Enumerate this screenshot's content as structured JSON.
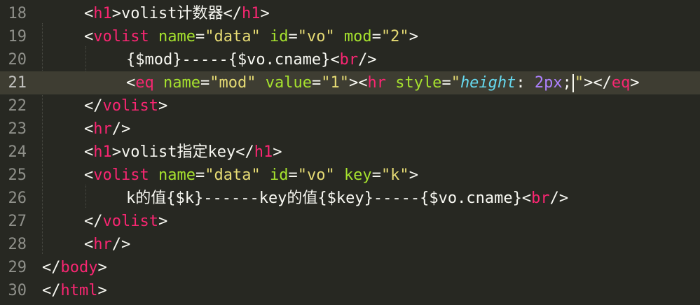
{
  "colors": {
    "background": "#272822",
    "current_line": "#3E3D32",
    "tag": "#F92672",
    "attribute": "#A6E22E",
    "string": "#E6DB74",
    "text": "#F8F8F2",
    "css_property": "#66D9EF",
    "number": "#AE81FF",
    "line_number": "#8F908A"
  },
  "editor": {
    "current_line_number": 21,
    "lines": [
      {
        "number": "18",
        "tokens": [
          {
            "t": "<",
            "k": "punct"
          },
          {
            "t": "h1",
            "k": "tag"
          },
          {
            "t": ">",
            "k": "punct"
          },
          {
            "t": "volist计数器",
            "k": "text"
          },
          {
            "t": "</",
            "k": "punct"
          },
          {
            "t": "h1",
            "k": "tag"
          },
          {
            "t": ">",
            "k": "punct"
          }
        ]
      },
      {
        "number": "19",
        "tokens": [
          {
            "t": "<",
            "k": "punct"
          },
          {
            "t": "volist",
            "k": "tag"
          },
          {
            "t": " ",
            "k": "text"
          },
          {
            "t": "name",
            "k": "attr"
          },
          {
            "t": "=",
            "k": "punct"
          },
          {
            "t": "\"data\"",
            "k": "str"
          },
          {
            "t": " ",
            "k": "text"
          },
          {
            "t": "id",
            "k": "attr"
          },
          {
            "t": "=",
            "k": "punct"
          },
          {
            "t": "\"vo\"",
            "k": "str"
          },
          {
            "t": " ",
            "k": "text"
          },
          {
            "t": "mod",
            "k": "attr"
          },
          {
            "t": "=",
            "k": "punct"
          },
          {
            "t": "\"2\"",
            "k": "str"
          },
          {
            "t": ">",
            "k": "punct"
          }
        ]
      },
      {
        "number": "20",
        "tokens": [
          {
            "t": "{$mod}-----{$vo.cname}",
            "k": "text"
          },
          {
            "t": "<",
            "k": "punct"
          },
          {
            "t": "br",
            "k": "tag"
          },
          {
            "t": "/>",
            "k": "punct"
          }
        ]
      },
      {
        "number": "21",
        "tokens": [
          {
            "t": "<",
            "k": "punct"
          },
          {
            "t": "eq",
            "k": "tag"
          },
          {
            "t": " ",
            "k": "text"
          },
          {
            "t": "name",
            "k": "attr"
          },
          {
            "t": "=",
            "k": "punct"
          },
          {
            "t": "\"mod\"",
            "k": "str"
          },
          {
            "t": " ",
            "k": "text"
          },
          {
            "t": "value",
            "k": "attr"
          },
          {
            "t": "=",
            "k": "punct"
          },
          {
            "t": "\"1\"",
            "k": "str"
          },
          {
            "t": "><",
            "k": "punct"
          },
          {
            "t": "hr",
            "k": "tag"
          },
          {
            "t": " ",
            "k": "text"
          },
          {
            "t": "style",
            "k": "attr"
          },
          {
            "t": "=",
            "k": "punct"
          },
          {
            "t": "\"",
            "k": "str"
          },
          {
            "t": "height",
            "k": "prop"
          },
          {
            "t": ": ",
            "k": "punct"
          },
          {
            "t": "2px",
            "k": "num"
          },
          {
            "t": ";",
            "k": "punct"
          },
          {
            "t": "",
            "k": "caret"
          },
          {
            "t": "\"",
            "k": "str"
          },
          {
            "t": "></",
            "k": "punct"
          },
          {
            "t": "eq",
            "k": "tag"
          },
          {
            "t": ">",
            "k": "punct"
          }
        ]
      },
      {
        "number": "22",
        "tokens": [
          {
            "t": "</",
            "k": "punct"
          },
          {
            "t": "volist",
            "k": "tag"
          },
          {
            "t": ">",
            "k": "punct"
          }
        ]
      },
      {
        "number": "23",
        "tokens": [
          {
            "t": "<",
            "k": "punct"
          },
          {
            "t": "hr",
            "k": "tag"
          },
          {
            "t": "/>",
            "k": "punct"
          }
        ]
      },
      {
        "number": "24",
        "tokens": [
          {
            "t": "<",
            "k": "punct"
          },
          {
            "t": "h1",
            "k": "tag"
          },
          {
            "t": ">",
            "k": "punct"
          },
          {
            "t": "volist指定key",
            "k": "text"
          },
          {
            "t": "</",
            "k": "punct"
          },
          {
            "t": "h1",
            "k": "tag"
          },
          {
            "t": ">",
            "k": "punct"
          }
        ]
      },
      {
        "number": "25",
        "tokens": [
          {
            "t": "<",
            "k": "punct"
          },
          {
            "t": "volist",
            "k": "tag"
          },
          {
            "t": " ",
            "k": "text"
          },
          {
            "t": "name",
            "k": "attr"
          },
          {
            "t": "=",
            "k": "punct"
          },
          {
            "t": "\"data\"",
            "k": "str"
          },
          {
            "t": " ",
            "k": "text"
          },
          {
            "t": "id",
            "k": "attr"
          },
          {
            "t": "=",
            "k": "punct"
          },
          {
            "t": "\"vo\"",
            "k": "str"
          },
          {
            "t": " ",
            "k": "text"
          },
          {
            "t": "key",
            "k": "attr"
          },
          {
            "t": "=",
            "k": "punct"
          },
          {
            "t": "\"k\"",
            "k": "str"
          },
          {
            "t": ">",
            "k": "punct"
          }
        ]
      },
      {
        "number": "26",
        "tokens": [
          {
            "t": "k的值{$k}------key的值{$key}-----{$vo.cname}",
            "k": "text"
          },
          {
            "t": "<",
            "k": "punct"
          },
          {
            "t": "br",
            "k": "tag"
          },
          {
            "t": "/>",
            "k": "punct"
          }
        ]
      },
      {
        "number": "27",
        "tokens": [
          {
            "t": "</",
            "k": "punct"
          },
          {
            "t": "volist",
            "k": "tag"
          },
          {
            "t": ">",
            "k": "punct"
          }
        ]
      },
      {
        "number": "28",
        "tokens": [
          {
            "t": "<",
            "k": "punct"
          },
          {
            "t": "hr",
            "k": "tag"
          },
          {
            "t": "/>",
            "k": "punct"
          }
        ]
      },
      {
        "number": "29",
        "tokens": [
          {
            "t": "</",
            "k": "punct"
          },
          {
            "t": "body",
            "k": "tag"
          },
          {
            "t": ">",
            "k": "punct"
          }
        ]
      },
      {
        "number": "30",
        "tokens": [
          {
            "t": "</",
            "k": "punct"
          },
          {
            "t": "html",
            "k": "tag"
          },
          {
            "t": ">",
            "k": "punct"
          }
        ]
      }
    ]
  }
}
